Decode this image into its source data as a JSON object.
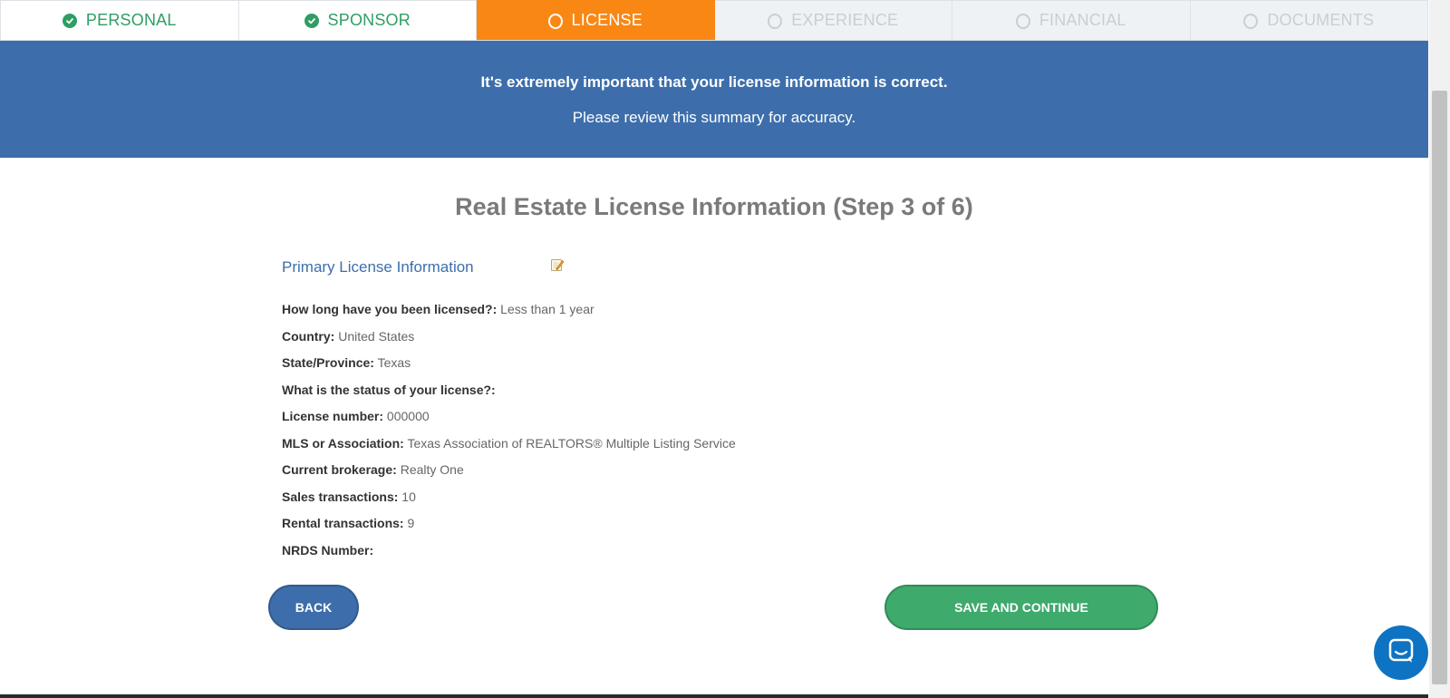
{
  "steps": [
    {
      "label": "PERSONAL",
      "state": "done"
    },
    {
      "label": "SPONSOR",
      "state": "done"
    },
    {
      "label": "LICENSE",
      "state": "active"
    },
    {
      "label": "EXPERIENCE",
      "state": "pending"
    },
    {
      "label": "FINANCIAL",
      "state": "pending"
    },
    {
      "label": "DOCUMENTS",
      "state": "pending"
    }
  ],
  "banner": {
    "line1": "It's extremely important that your license information is correct.",
    "line2": "Please review this summary for accuracy."
  },
  "page_title": "Real Estate License Information (Step 3 of 6)",
  "section": {
    "heading": "Primary License Information",
    "edit_icon": "pencil-icon"
  },
  "fields": [
    {
      "label": "How long have you been licensed?:",
      "value": "Less than 1 year"
    },
    {
      "label": "Country:",
      "value": "United States"
    },
    {
      "label": "State/Province:",
      "value": "Texas"
    },
    {
      "label": "What is the status of your license?:",
      "value": ""
    },
    {
      "label": "License number:",
      "value": "000000"
    },
    {
      "label": "MLS or Association:",
      "value": "Texas Association of REALTORS® Multiple Listing Service"
    },
    {
      "label": "Current brokerage:",
      "value": "Realty One"
    },
    {
      "label": "Sales transactions:",
      "value": "10"
    },
    {
      "label": "Rental transactions:",
      "value": "9"
    },
    {
      "label": "NRDS Number:",
      "value": ""
    }
  ],
  "buttons": {
    "back": "BACK",
    "save": "SAVE AND CONTINUE"
  },
  "colors": {
    "done": "#2e9e63",
    "active": "#f98714",
    "pending": "#c9ced4",
    "banner": "#3d6eab",
    "save": "#3eaa6b"
  }
}
